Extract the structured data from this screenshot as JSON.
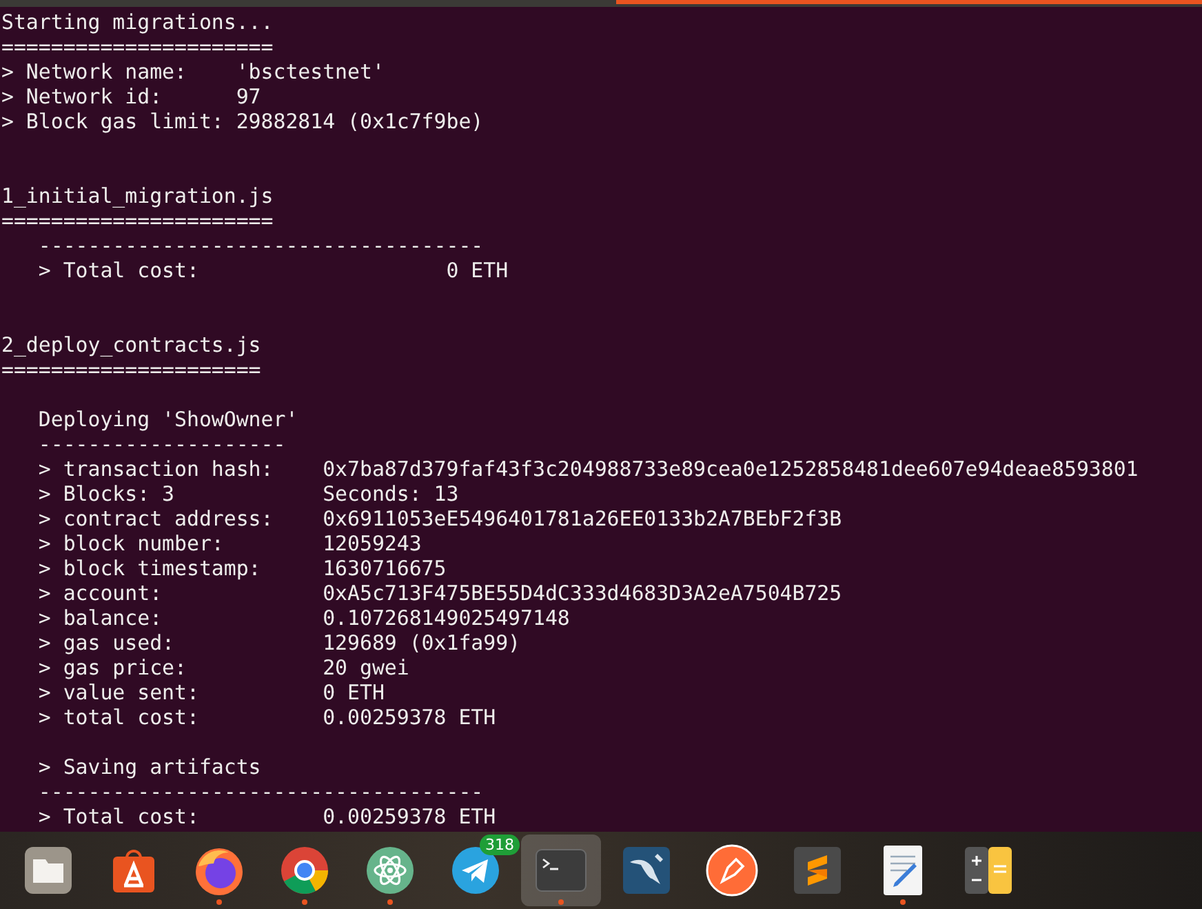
{
  "terminal": {
    "blocks": [
      {
        "kind": "first",
        "lines": [
          "Starting migrations...",
          "======================",
          "> Network name:    'bsctestnet'",
          "> Network id:      97",
          "> Block gas limit: 29882814 (0x1c7f9be)"
        ]
      },
      {
        "kind": "section",
        "lines": [
          "1_initial_migration.js",
          "======================",
          "   ------------------------------------",
          "   > Total cost:                    0 ETH"
        ]
      },
      {
        "kind": "section",
        "lines": [
          "2_deploy_contracts.js",
          "====================="
        ]
      },
      {
        "kind": "subsection",
        "lines": [
          "   Deploying 'ShowOwner'",
          "   --------------------",
          "   > transaction hash:    0x7ba87d379faf43f3c204988733e89cea0e1252858481dee607e94deae8593801",
          "   > Blocks: 3            Seconds: 13",
          "   > contract address:    0x6911053eE5496401781a26EE0133b2A7BEbF2f3B",
          "   > block number:        12059243",
          "   > block timestamp:     1630716675",
          "   > account:             0xA5c713F475BE55D4dC333d4683D3A2eA7504B725",
          "   > balance:             0.107268149025497148",
          "   > gas used:            129689 (0x1fa99)",
          "   > gas price:           20 gwei",
          "   > value sent:          0 ETH",
          "   > total cost:          0.00259378 ETH"
        ]
      },
      {
        "kind": "subsection",
        "lines": [
          "   > Saving artifacts",
          "   ------------------------------------",
          "   > Total cost:          0.00259378 ETH"
        ]
      }
    ]
  },
  "dock": [
    {
      "kind": "files",
      "running": false,
      "selected": false
    },
    {
      "kind": "store",
      "running": false,
      "selected": false
    },
    {
      "kind": "firefox",
      "running": true,
      "selected": false
    },
    {
      "kind": "chrome",
      "running": true,
      "selected": false
    },
    {
      "kind": "atom",
      "running": true,
      "selected": false
    },
    {
      "kind": "telegram",
      "running": false,
      "selected": false,
      "badge": "318"
    },
    {
      "kind": "terminal",
      "running": true,
      "selected": true
    },
    {
      "kind": "mysql",
      "running": false,
      "selected": false
    },
    {
      "kind": "postman",
      "running": false,
      "selected": false
    },
    {
      "kind": "sublime",
      "running": false,
      "selected": false
    },
    {
      "kind": "editor",
      "running": true,
      "selected": false
    },
    {
      "kind": "calculator",
      "running": false,
      "selected": false
    }
  ]
}
